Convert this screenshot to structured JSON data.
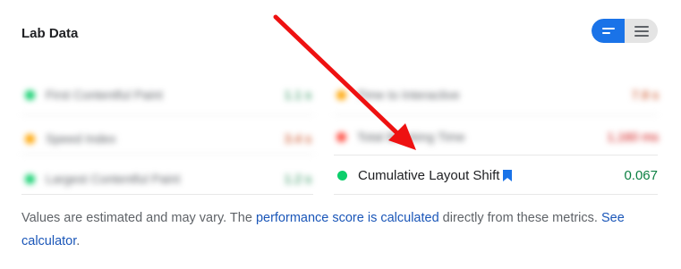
{
  "header": {
    "title": "Lab Data",
    "view_toggle": {
      "left_icon": "bar-view-icon",
      "right_icon": "list-view-icon",
      "active": "left"
    }
  },
  "blurred_metrics_left": [
    {
      "label": "First Contentful Paint",
      "value": "1.1 s",
      "status_color": "#0cce6b"
    },
    {
      "label": "Speed Index",
      "value": "3.4 s",
      "status_color": "#ffa400"
    },
    {
      "label": "Largest Contentful Paint",
      "value": "1.2 s",
      "status_color": "#0cce6b"
    }
  ],
  "blurred_metrics_right": [
    {
      "label": "Time to Interactive",
      "value": "7.8 s",
      "status_color": "#ffa400"
    },
    {
      "label": "Total Blocking Time",
      "value": "1,160 ms",
      "status_color": "#ff4e42"
    }
  ],
  "highlighted_metric": {
    "label": "Cumulative Layout Shift",
    "value": "0.067",
    "status_color": "#0cce6b",
    "icon": "bookmark-icon"
  },
  "footer": {
    "text_1": "Values are estimated and may vary. The ",
    "link_1": "performance score is calculated",
    "text_2": " directly from these metrics. ",
    "link_2": "See calculator",
    "text_3": "."
  },
  "annotation": {
    "arrow_color": "#ee1111"
  }
}
